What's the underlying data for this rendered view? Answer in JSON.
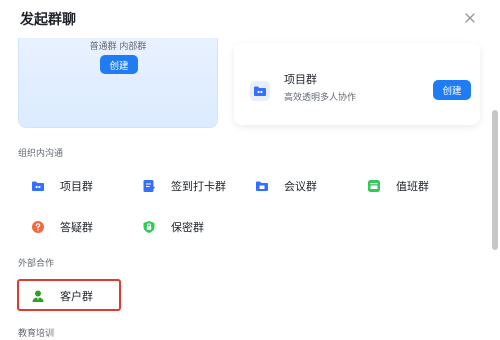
{
  "dialog": {
    "title": "发起群聊"
  },
  "cards": {
    "left": {
      "subtitle": "普通群  内部群",
      "create_label": "创建"
    },
    "right": {
      "name": "项目群",
      "desc": "高效透明多人协作",
      "create_label": "创建",
      "icon": "folder-group-icon"
    }
  },
  "sections": {
    "internal": {
      "title": "组织内沟通",
      "items": [
        {
          "label": "项目群",
          "icon": "folder-group-icon",
          "color": "#3370ff"
        },
        {
          "label": "签到打卡群",
          "icon": "checkin-icon",
          "color": "#3370ff"
        },
        {
          "label": "会议群",
          "icon": "meeting-folder-icon",
          "color": "#3370ff"
        },
        {
          "label": "值班群",
          "icon": "duty-icon",
          "color": "#34c759"
        },
        {
          "label": "答疑群",
          "icon": "question-icon",
          "color": "#f5683d"
        },
        {
          "label": "保密群",
          "icon": "lock-shield-icon",
          "color": "#34c759"
        }
      ]
    },
    "external": {
      "title": "外部合作",
      "items": [
        {
          "label": "客户群",
          "icon": "customer-icon",
          "color": "#2ea121"
        }
      ]
    },
    "education": {
      "title": "教育培训"
    }
  },
  "colors": {
    "accent": "#1f7cf5",
    "highlight_border": "#e03a2f"
  }
}
